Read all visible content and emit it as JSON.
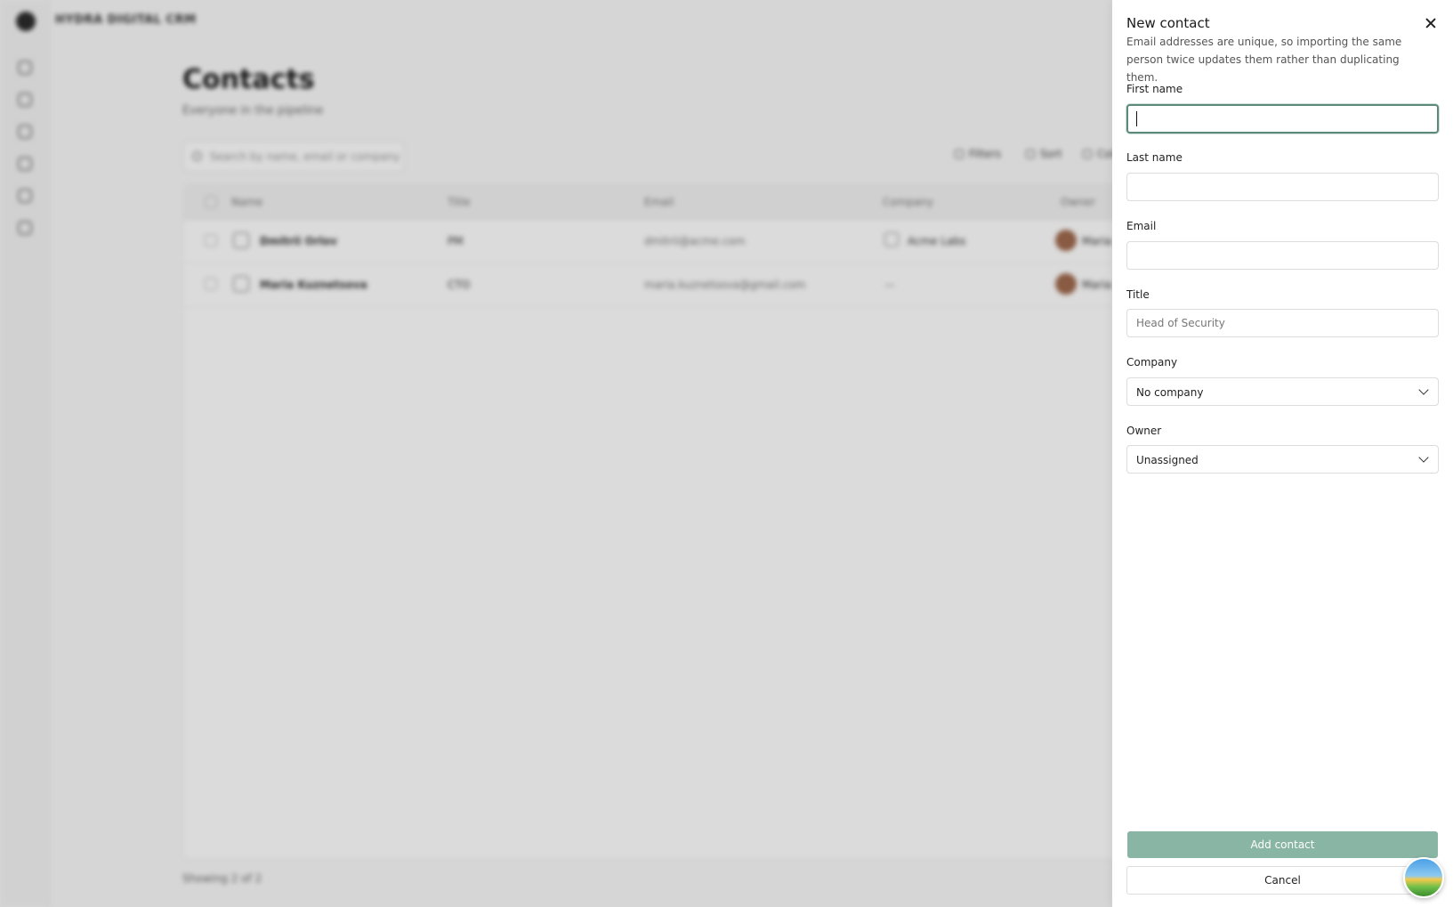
{
  "app": {
    "org_name": "HYDRA DIGITAL CRM",
    "rail_icons": [
      "home-icon",
      "inbox-icon",
      "deals-icon",
      "contacts-icon",
      "calendar-icon",
      "settings-icon"
    ]
  },
  "page": {
    "title": "Contacts",
    "subtitle": "Everyone in the pipeline",
    "search_placeholder": "Search by name, email or company",
    "toolbar": {
      "filters": "Filters",
      "sort": "Sort",
      "columns": "Columns"
    },
    "columns": [
      "Name",
      "Title",
      "Email",
      "Company",
      "Owner"
    ],
    "rows": [
      {
        "name": "Dmitrii Orlov",
        "title": "PM",
        "email": "dmitrii@acme.com",
        "company": "Acme Labs",
        "owner": "Maria"
      },
      {
        "name": "Maria Kuznetsova",
        "title": "CTO",
        "email": "maria.kuznetsova@gmail.com",
        "company": "—",
        "owner": "Maria"
      }
    ],
    "footer": "Showing 2 of 2"
  },
  "drawer": {
    "title": "New contact",
    "description": "Email addresses are unique, so importing the same person twice updates them rather than duplicating them.",
    "fields": {
      "first_name": {
        "label": "First name",
        "value": "",
        "placeholder": ""
      },
      "last_name": {
        "label": "Last name",
        "value": "",
        "placeholder": ""
      },
      "email": {
        "label": "Email",
        "value": "",
        "placeholder": ""
      },
      "title": {
        "label": "Title",
        "value": "",
        "placeholder": "Head of Security"
      },
      "company": {
        "label": "Company",
        "selected": "No company"
      },
      "owner": {
        "label": "Owner",
        "selected": "Unassigned"
      }
    },
    "submit_label": "Add contact",
    "cancel_label": "Cancel"
  },
  "colors": {
    "accent": "#89b5a5",
    "focus_border": "#5c8a7a"
  }
}
